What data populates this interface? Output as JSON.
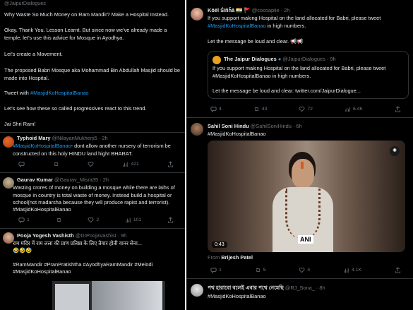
{
  "left": {
    "top_post": {
      "handle": "@JaipurDialogues",
      "paragraphs": [
        "Why Waste So Much Money on Ram Mandir? Make a Hospital Instead.",
        "Okay. Thank You. Lesson Learnt. But since now we've already made a temple, let's use this advice for Mosque in Ayodhya.",
        "Let's create a Movement.",
        "The proposed Babri Mosque aka Mohammad Bin Abdullah Masjid should be made into Hospital.",
        "Let's see how these so called progressives react to this trend.",
        "Jai Shri Ram!"
      ],
      "tweet_with_prefix": "Tweet with ",
      "tweet_with_tag": "#MasjidKoHospitalBanao"
    },
    "reply1": {
      "name": "Typhoid Mary",
      "handle": "@NilayanMukherji5",
      "time": "· 2h",
      "tag": "#MasjidKoHospitalBanao",
      "text": "- dont allow another nursery of terrorism be constructed  on this holy HINDU land hight BHARAT.",
      "views": "421"
    },
    "reply2": {
      "name": "Gaurav Kumar",
      "handle": "@Gaurav_Misra35",
      "time": "· 2h",
      "text": "Wasting crores of money on building a mosque while there are laihs of mosque in country is total waste of money. Instead build a hospital or school(not madarsha because they will produce rapist and terrorist).",
      "tag": "#MasjidKoHospitalBanao",
      "replies": "1",
      "likes": "2",
      "views": "101"
    },
    "reply3": {
      "name": "Pooja Yogesh Vashisth",
      "handle": "@DrPoojaVashist",
      "time": "· 9h",
      "text": "राम मंदिर में राम लला की प्राण प्रतिष्ठा के लिए तैयार होती वानर सेना...",
      "emojis": "🤣🤣🤣",
      "tags": "#RamMandir #PranPratishtha #AyodhyaRamMandir #Melodi",
      "tags2": "#MasjidKoHospitalBanao"
    }
  },
  "right": {
    "post1": {
      "name": "Kōël Śïñĥå",
      "flags": "🇮🇳 🚩",
      "handle": "@cocoapiie",
      "time": "· 2h",
      "text": "If you support making Hospital on the land allocated for Babri, please tweet",
      "tag": "#MasjidKoHospitalBanao",
      "text_after": " in high numbers.",
      "line2": "Let the message be loud and clear.",
      "emoji2": "📢📢",
      "quote": {
        "name": "The Jaipur Dialogues",
        "handle": "@JaipurDialogues",
        "time": "· 9h",
        "text": "If you support making Hospital on the land allocated for Babri, please tweet #MasjidKoHospitalBanao in high numbers.",
        "line2": "Let the message be loud and clear. twitter.com/JaipurDialogue..."
      },
      "replies": "4",
      "retweets": "43",
      "likes": "72",
      "views": "6.4K"
    },
    "post2": {
      "name": "Sahil Soni Hindu",
      "handle": "@SahilSoniHindu",
      "time": "· 6h",
      "tag": "#MasjidKoHospitalBanao",
      "video_time": "0:43",
      "from_label": "From",
      "from_name": "Brijesh Patel",
      "ani": "ANI",
      "replies": "1",
      "retweets": "5",
      "likes": "4",
      "views": "4.1K"
    },
    "post3": {
      "name": "পথ হারাবো বলেই এবার পথে নেমেছি",
      "handle": "@RJ_Sona_",
      "time": "· 8h",
      "tag": "#MasjidKoHospitalBanao"
    }
  },
  "colors": {
    "accent": "#1d9bf0",
    "muted": "#71767b",
    "bg": "#000000"
  }
}
